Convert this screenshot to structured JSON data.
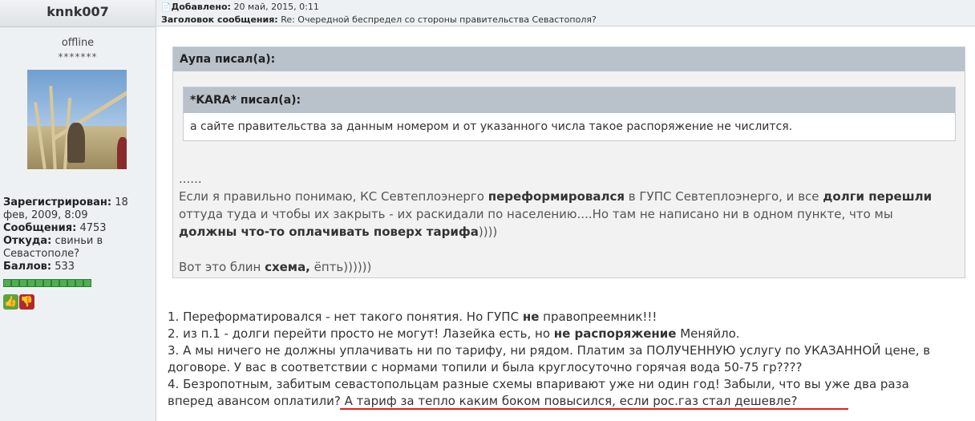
{
  "author": {
    "username": "knnk007",
    "status": "offline",
    "rank_stars": "*******",
    "registered_label": "Зарегистрирован:",
    "registered_value": "18 фев, 2009, 8:09",
    "messages_label": "Сообщения:",
    "messages_value": "4753",
    "from_label": "Откуда:",
    "from_value": "свиньи в Севастополе?",
    "points_label": "Баллов:",
    "points_value": "533",
    "reputation_segments": 11
  },
  "post_header": {
    "icon": "document-icon",
    "added_label": "Добавлено:",
    "added_value": "20 май, 2015, 0:11",
    "subject_label": "Заголовок сообщения:",
    "subject_value": "Re: Очередной беспредел со стороны правительства Севастополя?"
  },
  "outer_quote": {
    "title": "Аупа писал(а):",
    "body_dots": "......",
    "body_p1_a": "Если я правильно понимаю, КС Севтеплоэнерго ",
    "body_p1_b": "переформировался",
    "body_p1_c": " в ГУПС Севтеплоэнерго, и все ",
    "body_p1_d": "долги перешли",
    "body_p1_e": " оттуда туда и чтобы их закрыть - их раскидали по населению....Но там не написано ни в одном пункте, что мы ",
    "body_p1_f": "должны что-то оплачивать поверх тарифа",
    "body_p1_g": "))))",
    "body_p2_a": "Вот это блин ",
    "body_p2_b": "схема,",
    "body_p2_c": " ёпть))))))"
  },
  "inner_quote": {
    "title": "*KARA* писал(а):",
    "text": "а сайте правительства за данным номером и от указанного числа такое распоряжение не числится."
  },
  "post_body": {
    "l1_a": "1. Переформатировался - нет такого понятия. Но ГУПС ",
    "l1_b": "не",
    "l1_c": " правопреемник!!!",
    "l2_a": "2. из п.1 - долги перейти просто не могут! Лазейка есть, но ",
    "l2_b": "не распоряжение",
    "l2_c": " Меняйло.",
    "l3": "3. А мы ничего не должны уплачивать ни по тарифу, ни рядом. Платим за ПОЛУЧЕННУЮ услугу по УКАЗАННОЙ цене, в договоре. У вас в соответствии с нормами топили и была круглосуточно горячая вода 50-75 гр????",
    "l4": "4. Безропотным, забитым севастопольцам разные схемы впаривают уже ни один год! Забыли, что вы уже два раза вперед авансом оплатили? А тариф за тепло каким боком повысился, если рос.газ стал дешевле?"
  },
  "colors": {
    "accent_green": "#4caf50",
    "vote_down": "#b2282c",
    "underline": "#e02020"
  }
}
